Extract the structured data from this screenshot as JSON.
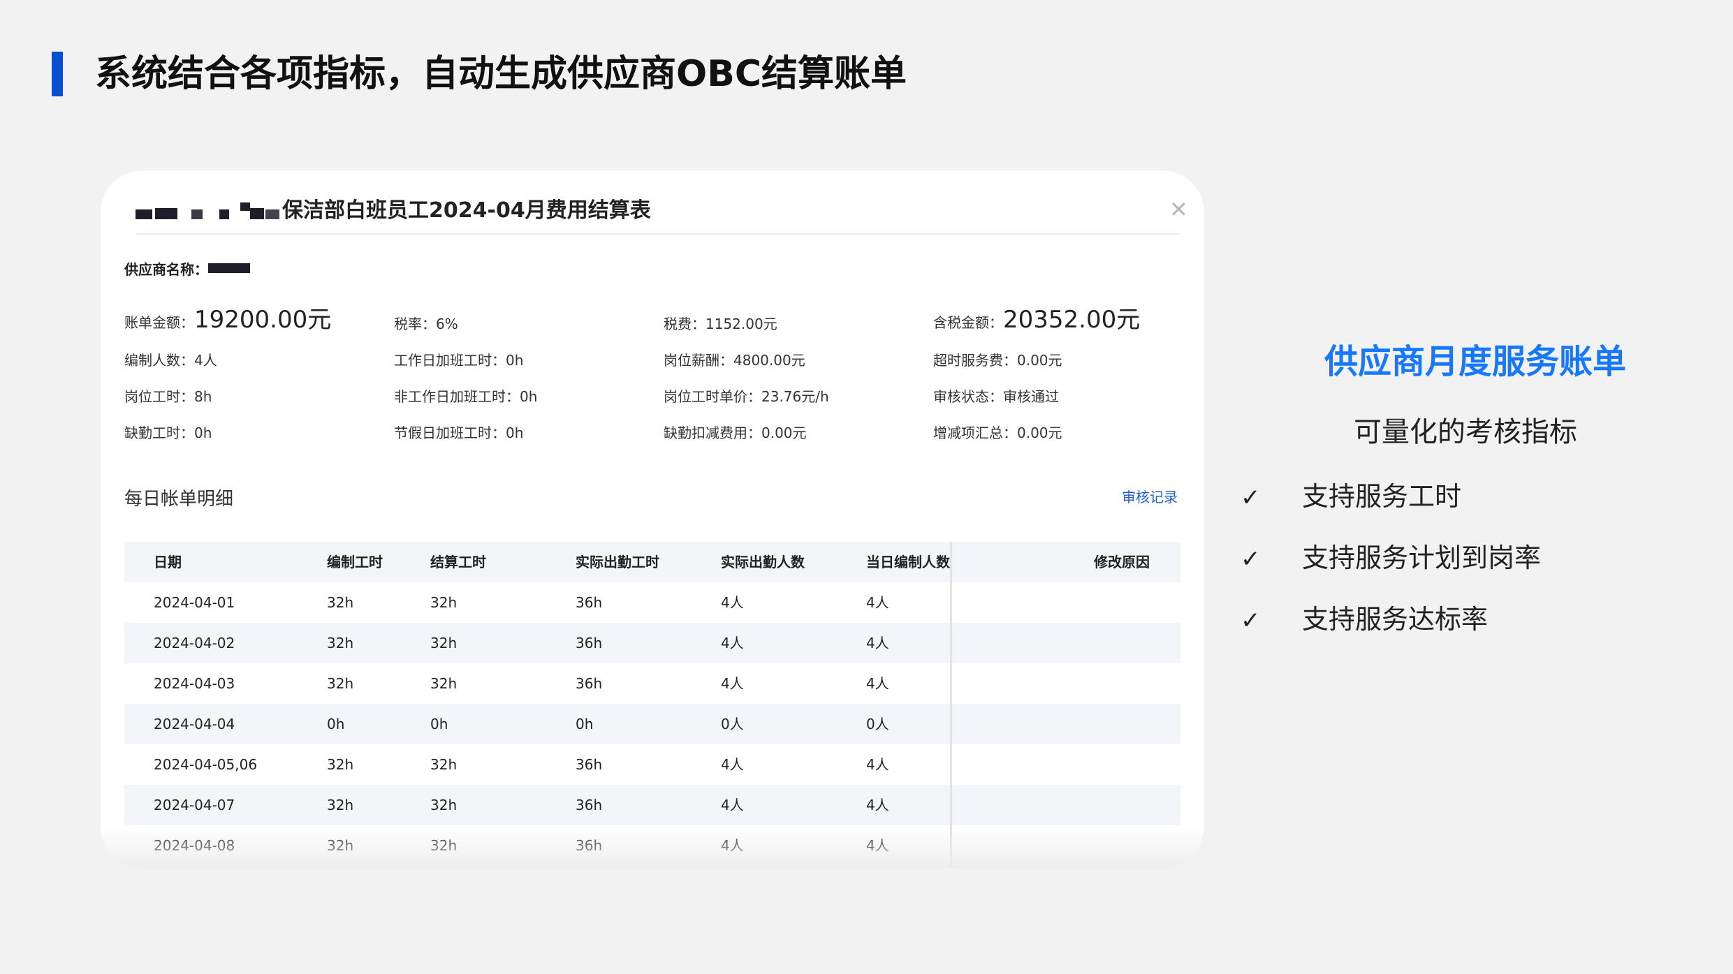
{
  "slide": {
    "title": "系统结合各项指标，自动生成供应商OBC结算账单",
    "accent_color": "#0a4fd1"
  },
  "sheet": {
    "title_suffix": "保洁部白班员工2024-04月费用结算表",
    "close_icon": "close-icon",
    "supplier_label": "供应商名称：",
    "fields": {
      "bill_amount_label": "账单金额：",
      "bill_amount_value": "19200.00元",
      "tax_rate": "税率：6%",
      "tax_fee": "税费：1152.00元",
      "total_label": "含税金额：",
      "total_value": "20352.00元",
      "headcount": "编制人数：4人",
      "workday_overtime": "工作日加班工时：0h",
      "position_salary": "岗位薪酬：4800.00元",
      "overtime_fee": "超时服务费：0.00元",
      "position_hours": "岗位工时：8h",
      "non_workday_overtime": "非工作日加班工时：0h",
      "hourly_price": "岗位工时单价：23.76元/h",
      "audit_status": "审核状态：审核通过",
      "absence_hours": "缺勤工时：0h",
      "holiday_overtime": "节假日加班工时：0h",
      "absence_deduction": "缺勤扣减费用：0.00元",
      "adjustment_total": "增减项汇总：0.00元"
    },
    "section_title": "每日帐单明细",
    "audit_link": "审核记录",
    "table": {
      "headers": [
        "日期",
        "编制工时",
        "结算工时",
        "实际出勤工时",
        "实际出勤人数",
        "当日编制人数",
        "修改原因"
      ],
      "rows": [
        [
          "2024-04-01",
          "32h",
          "32h",
          "36h",
          "4人",
          "4人",
          ""
        ],
        [
          "2024-04-02",
          "32h",
          "32h",
          "36h",
          "4人",
          "4人",
          ""
        ],
        [
          "2024-04-03",
          "32h",
          "32h",
          "36h",
          "4人",
          "4人",
          ""
        ],
        [
          "2024-04-04",
          "0h",
          "0h",
          "0h",
          "0人",
          "0人",
          ""
        ],
        [
          "2024-04-05,06",
          "32h",
          "32h",
          "36h",
          "4人",
          "4人",
          ""
        ],
        [
          "2024-04-07",
          "32h",
          "32h",
          "36h",
          "4人",
          "4人",
          ""
        ],
        [
          "2024-04-08",
          "32h",
          "32h",
          "36h",
          "4人",
          "4人",
          ""
        ]
      ]
    }
  },
  "right": {
    "heading": "供应商月度服务账单",
    "heading_color": "#1677ff",
    "subheading": "可量化的考核指标",
    "check_symbol": "✓",
    "bullets": [
      "支持服务工时",
      "支持服务计划到岗率",
      "支持服务达标率"
    ]
  }
}
